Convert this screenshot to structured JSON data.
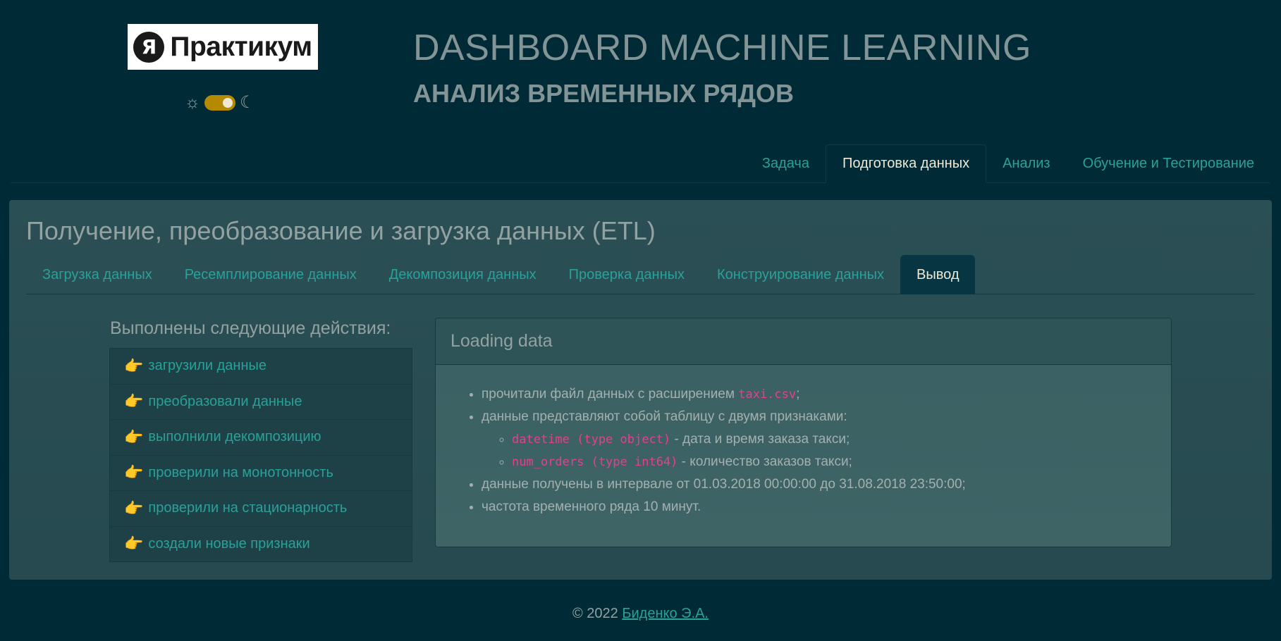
{
  "header": {
    "logo_mark": "Я",
    "logo_text": "Практикум",
    "title": "DASHBOARD MACHINE LEARNING",
    "subtitle": "АНАЛИЗ ВРЕМЕННЫХ РЯДОВ",
    "theme_toggle": {
      "light_icon": "sun-icon",
      "dark_icon": "moon-icon",
      "state": "on"
    }
  },
  "nav": {
    "tabs": [
      {
        "label": "Задача"
      },
      {
        "label": "Подготовка данных",
        "active": true
      },
      {
        "label": "Анализ"
      },
      {
        "label": "Обучение и Тестирование"
      }
    ]
  },
  "main": {
    "title": "Получение, преобразование и загрузка данных (ETL)",
    "tabs": [
      {
        "label": "Загрузка данных"
      },
      {
        "label": "Ресемплирование данных"
      },
      {
        "label": "Декомпозиция данных"
      },
      {
        "label": "Проверка данных"
      },
      {
        "label": "Конструирование данных"
      },
      {
        "label": "Вывод",
        "active": true
      }
    ],
    "actions_heading": "Выполнены следующие действия:",
    "actions": [
      {
        "icon": "👉",
        "label": "загрузили данные"
      },
      {
        "icon": "👉",
        "label": "преобразовали данные"
      },
      {
        "icon": "👉",
        "label": "выполнили декомпозицию"
      },
      {
        "icon": "👉",
        "label": "проверили на монотонность"
      },
      {
        "icon": "👉",
        "label": "проверили на стационарность"
      },
      {
        "icon": "👉",
        "label": "создали новые признаки"
      }
    ],
    "panel": {
      "title": "Loading data",
      "bullet1_text": "прочитали файл данных с расширением ",
      "bullet1_code": "taxi.csv",
      "bullet1_end": ";",
      "bullet2_text": "данные представляют собой таблицу с двумя признаками:",
      "sub1_code": "datetime (type object)",
      "sub1_text": " - дата и время заказа такси;",
      "sub2_code": "num_orders (type int64)",
      "sub2_text": " - количество заказов такси;",
      "bullet3_text": "данные получены в интервале от 01.03.2018 00:00:00 до 31.08.2018 23:50:00;",
      "bullet4_text": "частота временного ряда 10 минут."
    }
  },
  "footer": {
    "copyright": "© 2022 ",
    "author": "Биденко Э.А."
  },
  "colors": {
    "background": "#002b36",
    "accent": "#2aa198",
    "toggle": "#b58900",
    "code": "#e83e8c"
  }
}
